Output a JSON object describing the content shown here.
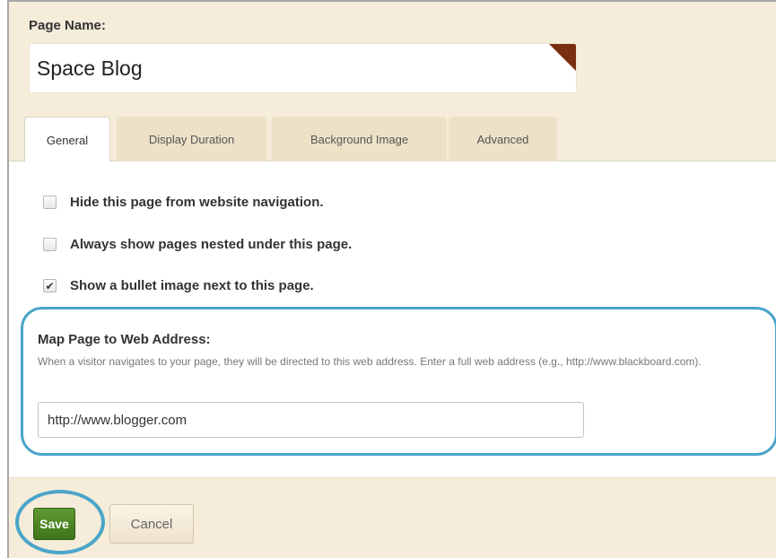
{
  "page_name": {
    "label": "Page Name:",
    "value": "Space Blog"
  },
  "tabs": [
    {
      "label": "General",
      "active": true
    },
    {
      "label": "Display Duration",
      "active": false
    },
    {
      "label": "Background Image",
      "active": false
    },
    {
      "label": "Advanced",
      "active": false
    }
  ],
  "options": [
    {
      "label": "Hide this page from website navigation.",
      "checked": false
    },
    {
      "label": "Always show pages nested under this page.",
      "checked": false
    },
    {
      "label": "Show a bullet image next to this page.",
      "checked": true
    }
  ],
  "map_address": {
    "title": "Map Page to Web Address:",
    "help": "When a visitor navigates to your page, they will be directed to this web address. Enter a full web address (e.g., http://www.blackboard.com).",
    "value": "http://www.blogger.com"
  },
  "actions": {
    "save_label": "Save",
    "cancel_label": "Cancel"
  },
  "colors": {
    "panel_background": "#f5edda",
    "highlight_ring": "#4aa5c9",
    "save_button": "#4b8224",
    "corner_flag": "#7a2f12"
  }
}
